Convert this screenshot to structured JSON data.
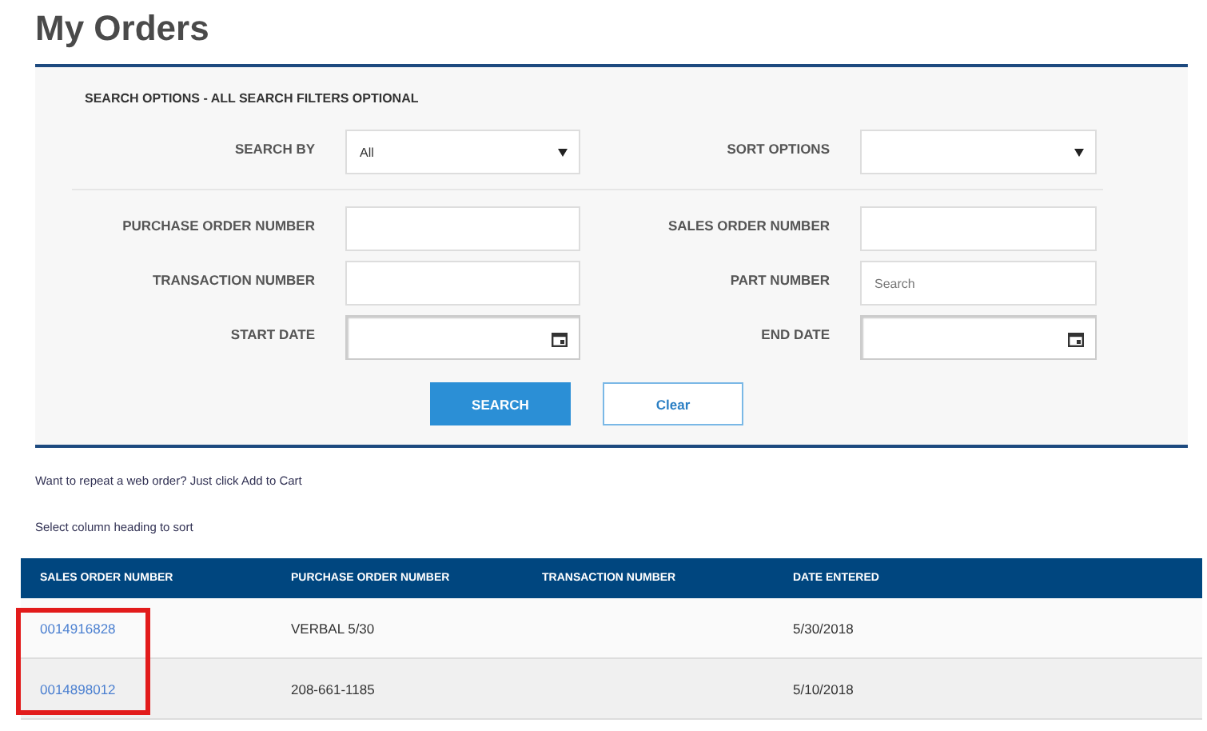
{
  "page": {
    "title": "My Orders"
  },
  "search_panel": {
    "heading": "SEARCH OPTIONS - ALL SEARCH FILTERS OPTIONAL",
    "top_row": [
      {
        "label": "SEARCH BY",
        "kind": "select",
        "value": "All"
      },
      {
        "label": "SORT OPTIONS",
        "kind": "select"
      }
    ],
    "rows": [
      [
        {
          "label": "PURCHASE ORDER NUMBER",
          "kind": "text"
        },
        {
          "label": "SALES ORDER NUMBER",
          "kind": "text"
        }
      ],
      [
        {
          "label": "TRANSACTION NUMBER",
          "kind": "text"
        },
        {
          "label": "PART NUMBER",
          "kind": "text",
          "placeholder": "Search"
        }
      ],
      [
        {
          "label": "START DATE",
          "kind": "date"
        },
        {
          "label": "END DATE",
          "kind": "date"
        }
      ]
    ],
    "buttons": [
      {
        "label": "SEARCH",
        "kind": "primary"
      },
      {
        "label": "Clear",
        "kind": "secondary"
      }
    ]
  },
  "notes": [
    "Want to repeat a web order? Just click Add to Cart",
    "Select column heading to sort"
  ],
  "table": {
    "columns": [
      "SALES ORDER NUMBER",
      "PURCHASE ORDER NUMBER",
      "TRANSACTION NUMBER",
      "DATE ENTERED"
    ],
    "rows": [
      [
        "0014916828",
        "VERBAL 5/30",
        "",
        "5/30/2018"
      ],
      [
        "0014898012",
        "208-661-1185",
        "",
        "5/10/2018"
      ]
    ]
  }
}
